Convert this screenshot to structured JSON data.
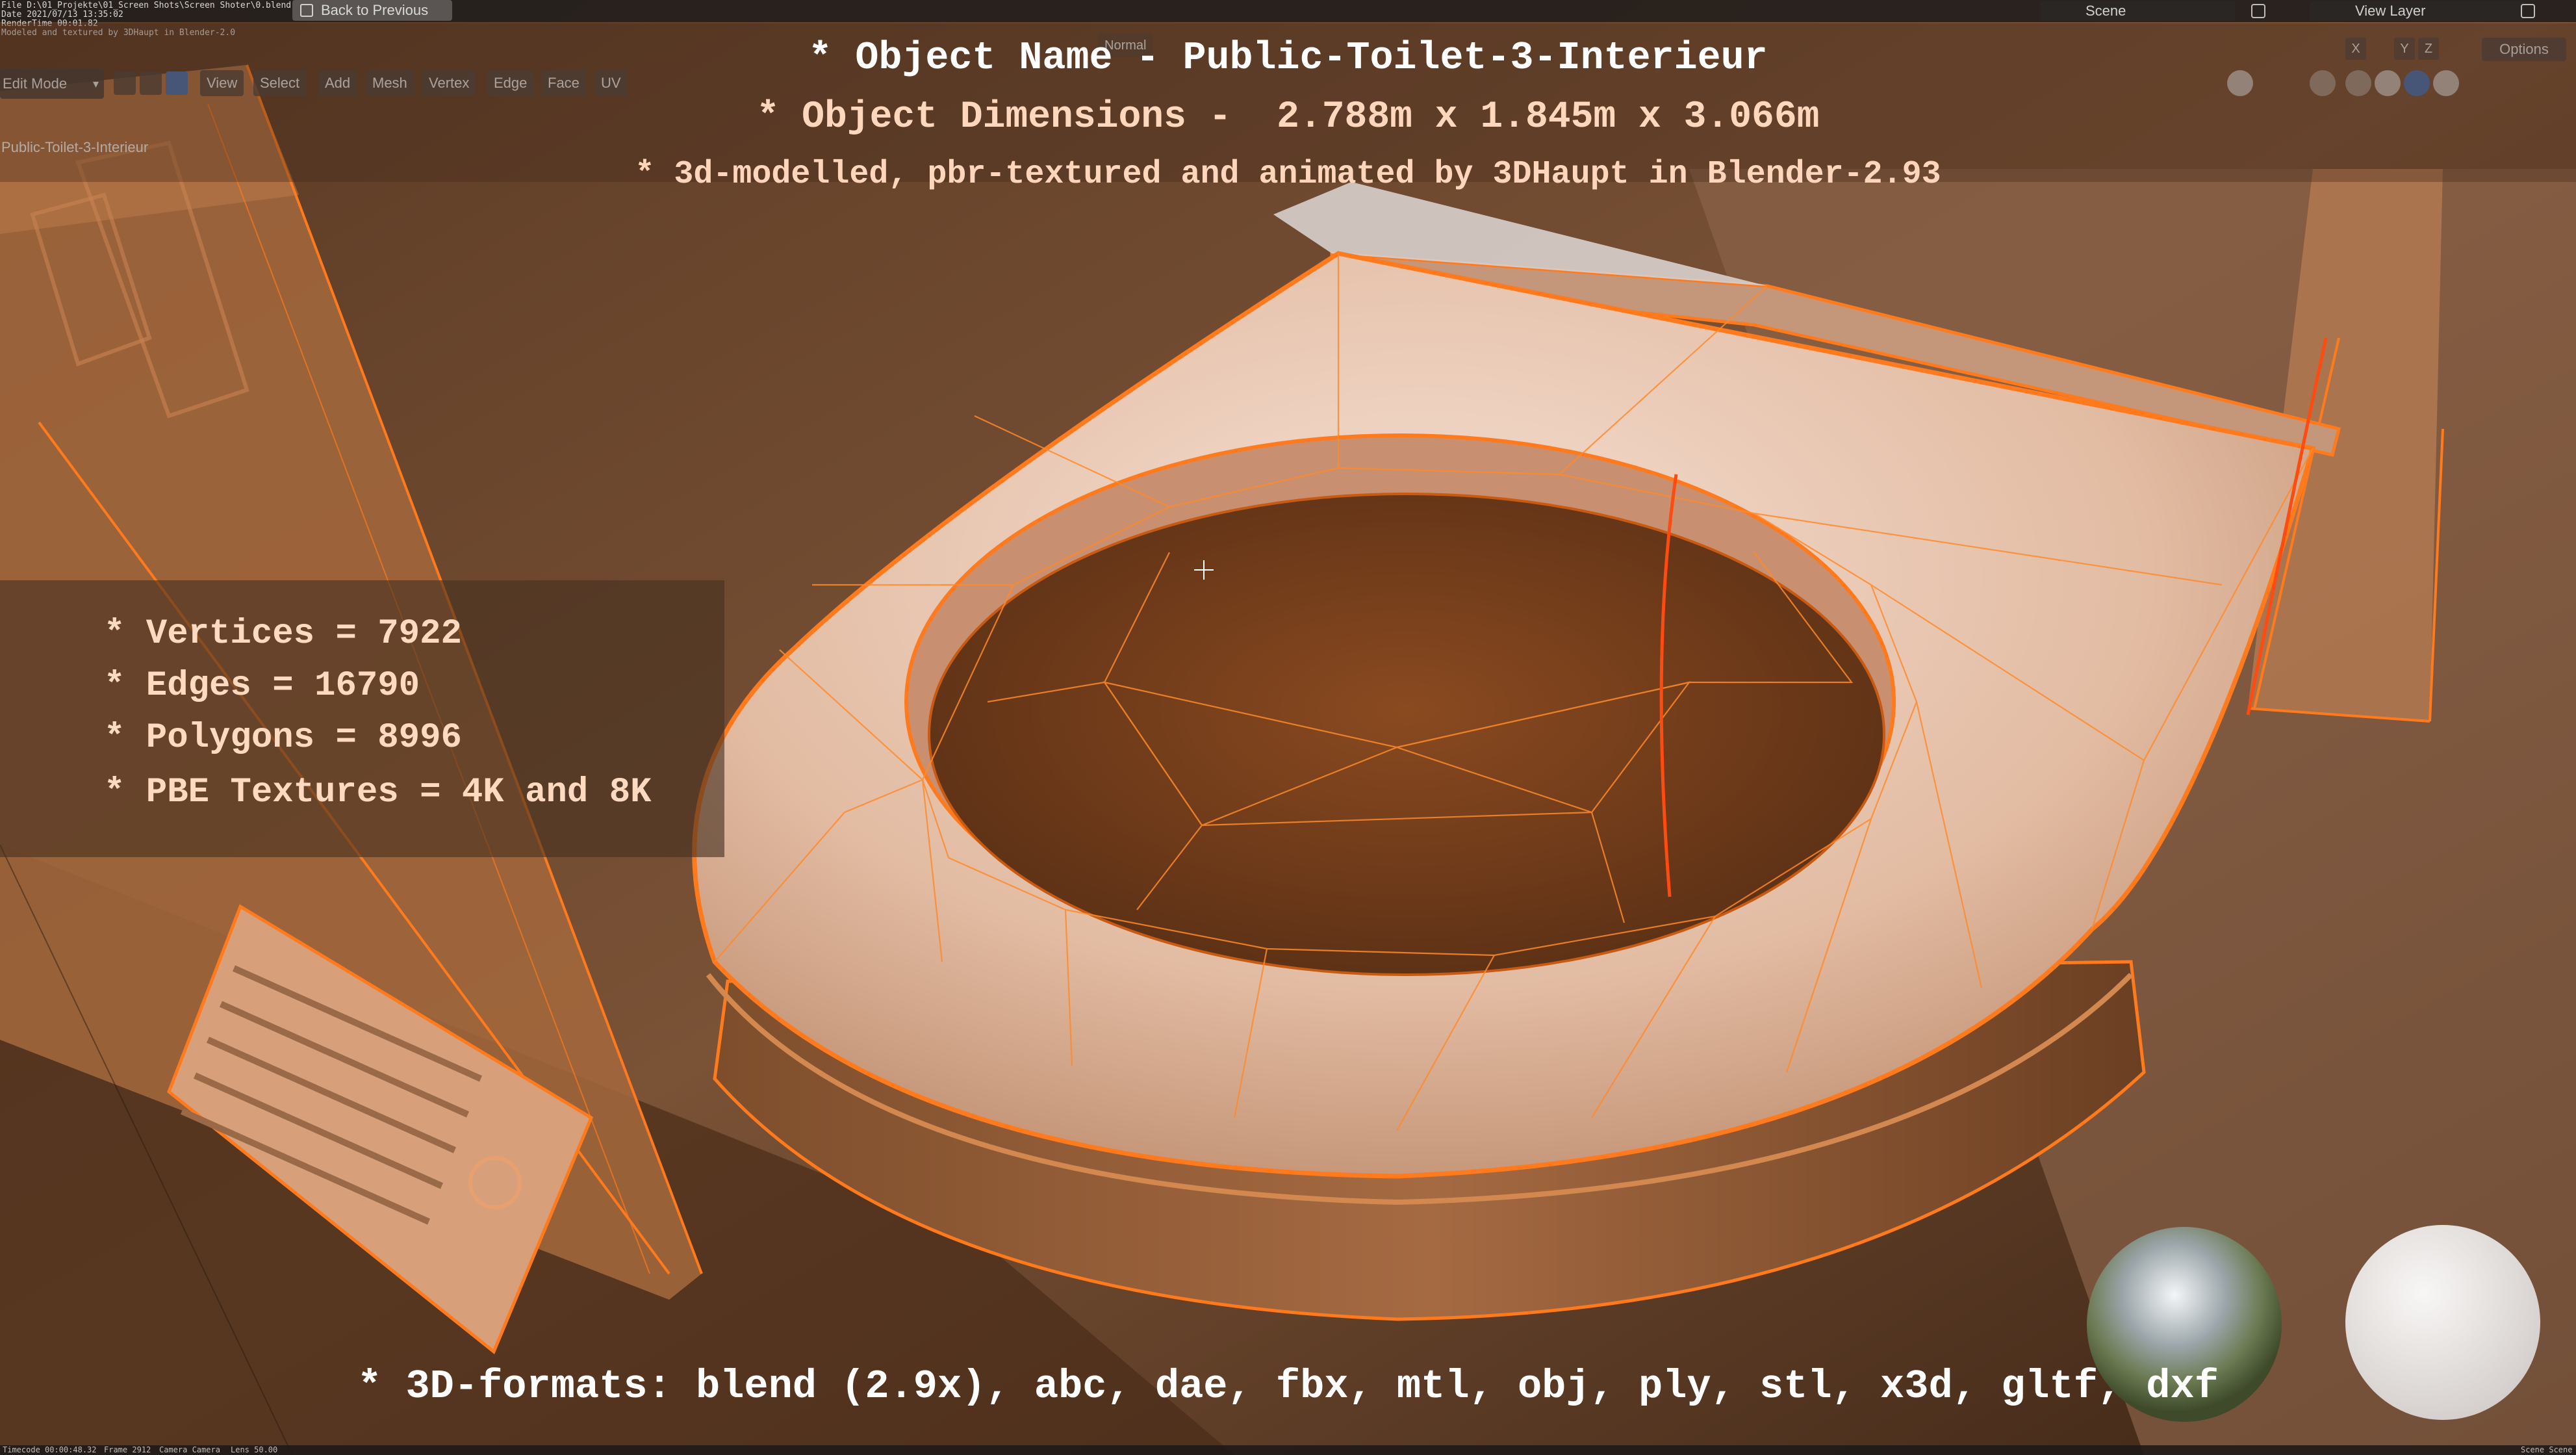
{
  "topbar": {
    "meta_lines": [
      "File D:\\01_Projekte\\01_Screen Shots\\Screen Shoter\\0.blend",
      "Date 2021/07/13 13:35:02",
      "RenderTime 00:01.82",
      "Modeled and textured by 3DHaupt in Blender-2.0"
    ],
    "back_button_label": "Back to Previous",
    "scene_label": "Scene",
    "view_layer_label": "View Layer"
  },
  "toolbar": {
    "mode_label": "Edit Mode",
    "menus": [
      "View",
      "Select",
      "Add",
      "Mesh",
      "Vertex",
      "Edge",
      "Face",
      "UV"
    ],
    "transform_orientation": "Normal",
    "options_label": "Options",
    "axes": [
      "X",
      "Y",
      "Z"
    ]
  },
  "viewport": {
    "object_label": "Public-Toilet-3-Interieur"
  },
  "overlay": {
    "title_line1": "* Object Name - Public-Toilet-3-Interieur",
    "title_line2": "* Object Dimensions -  2.788m x 1.845m x 3.066m",
    "title_line3": "* 3d-modelled, pbr-textured and animated by 3DHaupt in Blender-2.93",
    "stats": [
      "* Vertices = 7922",
      "* Edges = 16790",
      "* Polygons = 8996",
      "* PBE Textures = 4K and 8K"
    ],
    "formats": "* 3D-formats: blend (2.9x), abc, dae, fbx, mtl, obj, ply, stl, x3d, gltf, dxf"
  },
  "statusbar": {
    "timecode": "Timecode 00:00:48.32",
    "frame": "Frame 2912",
    "camera": "Camera Camera",
    "lens": "Lens 50.00",
    "scene": "Scene Scene"
  },
  "colors": {
    "wire": "#ff7a1c",
    "wire_dark": "#c85a12",
    "seat": "#e7c9b8",
    "bowl": "#6b3a1c",
    "overlay_text": "#ffd9c0"
  }
}
